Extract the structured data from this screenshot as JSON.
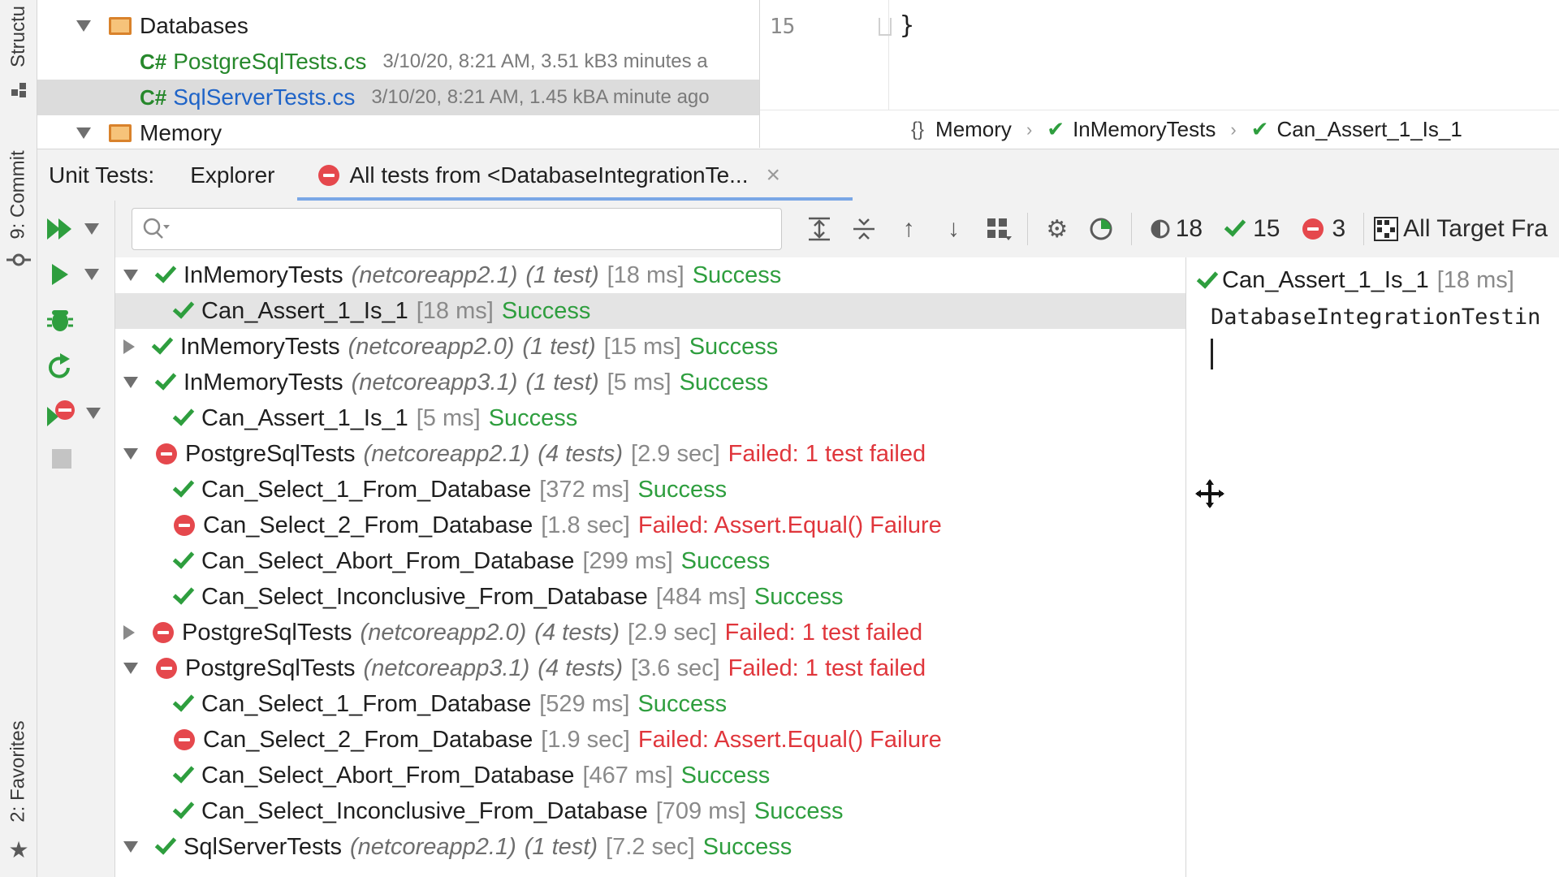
{
  "left_strip": {
    "structure": "Structu",
    "commit": "9: Commit",
    "favorites": "2: Favorites"
  },
  "project_tree": [
    {
      "kind": "folder",
      "label": "Databases"
    },
    {
      "kind": "file",
      "lang": "C#",
      "label": "PostgreSqlTests.cs",
      "meta": "3/10/20, 8:21 AM, 3.51 kB",
      "age": "3 minutes a",
      "selected": false
    },
    {
      "kind": "file",
      "lang": "C#",
      "label": "SqlServerTests.cs",
      "meta": "3/10/20, 8:21 AM, 1.45 kB",
      "age": "A minute ago",
      "selected": true
    },
    {
      "kind": "folder",
      "label": "Memory"
    }
  ],
  "editor": {
    "line_number": "15",
    "code": "}"
  },
  "breadcrumb": {
    "items": [
      "Memory",
      "InMemoryTests",
      "Can_Assert_1_Is_1"
    ]
  },
  "tool_window": {
    "title": "Unit Tests:",
    "tabs": [
      "Explorer",
      "All tests from <DatabaseIntegrationTe..."
    ],
    "close_glyph": "×"
  },
  "toolbar": {
    "search_placeholder": "",
    "counts": {
      "total": "18",
      "passed": "15",
      "failed": "3"
    },
    "target_label": "All Target Fra"
  },
  "tests": [
    {
      "name": "InMemoryTests",
      "fw": "(netcoreapp2.1)",
      "count": "(1 test)",
      "dur": "[18 ms]",
      "status": "Success",
      "result": "ok",
      "level": 0,
      "expand": "down"
    },
    {
      "name": "Can_Assert_1_Is_1",
      "dur": "[18 ms]",
      "status": "Success",
      "result": "ok",
      "level": 1,
      "selected": true
    },
    {
      "name": "InMemoryTests",
      "fw": "(netcoreapp2.0)",
      "count": "(1 test)",
      "dur": "[15 ms]",
      "status": "Success",
      "result": "ok",
      "level": 0,
      "expand": "right"
    },
    {
      "name": "InMemoryTests",
      "fw": "(netcoreapp3.1)",
      "count": "(1 test)",
      "dur": "[5 ms]",
      "status": "Success",
      "result": "ok",
      "level": 0,
      "expand": "down"
    },
    {
      "name": "Can_Assert_1_Is_1",
      "dur": "[5 ms]",
      "status": "Success",
      "result": "ok",
      "level": 1
    },
    {
      "name": "PostgreSqlTests",
      "fw": "(netcoreapp2.1)",
      "count": "(4 tests)",
      "dur": "[2.9 sec]",
      "status": "Failed: 1 test failed",
      "result": "bad",
      "level": 0,
      "expand": "down"
    },
    {
      "name": "Can_Select_1_From_Database",
      "dur": "[372 ms]",
      "status": "Success",
      "result": "ok",
      "level": 1
    },
    {
      "name": "Can_Select_2_From_Database",
      "dur": "[1.8 sec]",
      "status": "Failed: Assert.Equal() Failure",
      "result": "bad",
      "level": 1
    },
    {
      "name": "Can_Select_Abort_From_Database",
      "dur": "[299 ms]",
      "status": "Success",
      "result": "ok",
      "level": 1
    },
    {
      "name": "Can_Select_Inconclusive_From_Database",
      "dur": "[484 ms]",
      "status": "Success",
      "result": "ok",
      "level": 1
    },
    {
      "name": "PostgreSqlTests",
      "fw": "(netcoreapp2.0)",
      "count": "(4 tests)",
      "dur": "[2.9 sec]",
      "status": "Failed: 1 test failed",
      "result": "bad",
      "level": 0,
      "expand": "right"
    },
    {
      "name": "PostgreSqlTests",
      "fw": "(netcoreapp3.1)",
      "count": "(4 tests)",
      "dur": "[3.6 sec]",
      "status": "Failed: 1 test failed",
      "result": "bad",
      "level": 0,
      "expand": "down"
    },
    {
      "name": "Can_Select_1_From_Database",
      "dur": "[529 ms]",
      "status": "Success",
      "result": "ok",
      "level": 1
    },
    {
      "name": "Can_Select_2_From_Database",
      "dur": "[1.9 sec]",
      "status": "Failed: Assert.Equal() Failure",
      "result": "bad",
      "level": 1
    },
    {
      "name": "Can_Select_Abort_From_Database",
      "dur": "[467 ms]",
      "status": "Success",
      "result": "ok",
      "level": 1
    },
    {
      "name": "Can_Select_Inconclusive_From_Database",
      "dur": "[709 ms]",
      "status": "Success",
      "result": "ok",
      "level": 1
    },
    {
      "name": "SqlServerTests",
      "fw": "(netcoreapp2.1)",
      "count": "(1 test)",
      "dur": "[7.2 sec]",
      "status": "Success",
      "result": "ok",
      "level": 0,
      "expand": "down"
    }
  ],
  "output": {
    "title": "Can_Assert_1_Is_1",
    "dur": "[18 ms]",
    "body": "DatabaseIntegrationTestin"
  },
  "colors": {
    "success": "#2e9e3e",
    "failed": "#e0363c",
    "selection": "#e4e4e4",
    "tab_underline": "#7aa7e6"
  }
}
